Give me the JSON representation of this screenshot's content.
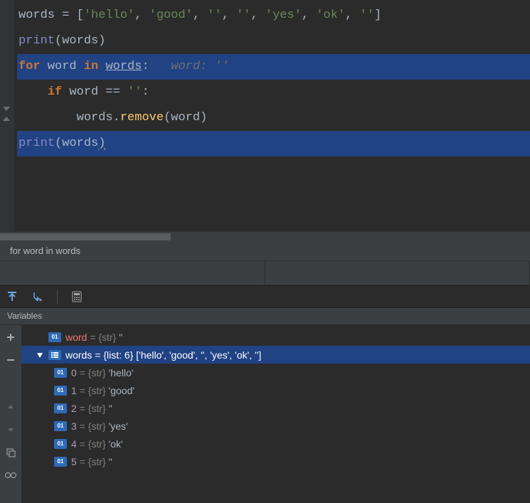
{
  "code": {
    "line1_var": "words",
    "line1_assign": " = [",
    "line1_strs": [
      "'hello'",
      "'good'",
      "''",
      "''",
      "'yes'",
      "'ok'",
      "''"
    ],
    "line1_close": "]",
    "line2_print": "print",
    "line2_open": "(",
    "line2_arg": "words",
    "line2_close": ")",
    "line3_for": "for",
    "line3_word": " word ",
    "line3_in": "in",
    "line3_words": "words",
    "line3_colon": ":",
    "line3_hint": "word: ''",
    "line4_if": "if",
    "line4_cond": " word == ",
    "line4_str": "''",
    "line4_colon": ":",
    "line5_words": "words.",
    "line5_remove": "remove",
    "line5_open": "(",
    "line5_arg": "word",
    "line5_close": ")",
    "line6_print": "print",
    "line6_open": "(",
    "line6_arg": "words",
    "line6_close": ")"
  },
  "breadcrumb": "for word in words",
  "panel_title": "Variables",
  "vars": {
    "word": {
      "name": "word",
      "type": "{str}",
      "value": "''"
    },
    "words": {
      "name": "words",
      "type": "{list: 6}",
      "value": "['hello', 'good', '', 'yes', 'ok', '']"
    },
    "items": [
      {
        "idx": "0",
        "type": "{str}",
        "value": "'hello'"
      },
      {
        "idx": "1",
        "type": "{str}",
        "value": "'good'"
      },
      {
        "idx": "2",
        "type": "{str}",
        "value": "''"
      },
      {
        "idx": "3",
        "type": "{str}",
        "value": "'yes'"
      },
      {
        "idx": "4",
        "type": "{str}",
        "value": "'ok'"
      },
      {
        "idx": "5",
        "type": "{str}",
        "value": "''"
      }
    ]
  }
}
